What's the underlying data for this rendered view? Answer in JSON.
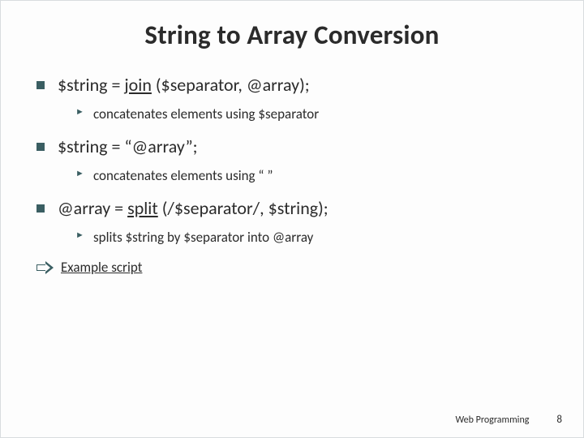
{
  "title": "String to Array Conversion",
  "items": [
    {
      "text_pre": "$string = ",
      "text_underlined": "join",
      "text_post": " ($separator, @array);",
      "sub": "concatenates elements using $separator"
    },
    {
      "text_pre": "$string = “@array”;",
      "text_underlined": "",
      "text_post": "",
      "sub": "concatenates elements using “ ”"
    },
    {
      "text_pre": "@array = ",
      "text_underlined": "split",
      "text_post": " (/$separator/, $string);",
      "sub": "splits $string by $separator into @array"
    }
  ],
  "example_link": "Example script",
  "footer": {
    "label": "Web Programming",
    "page": "8"
  }
}
